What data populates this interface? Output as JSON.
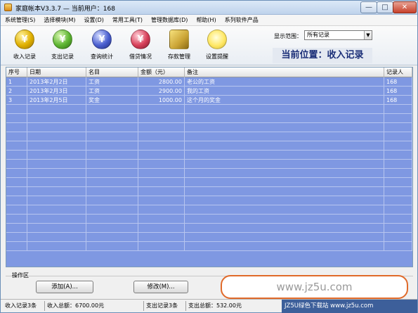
{
  "window": {
    "title": "家庭帐本V3.3.7  —  当前用户：168",
    "min_label": "—",
    "max_label": "□",
    "close_label": "✕"
  },
  "menu": [
    "系统管理(S)",
    "选择模块(M)",
    "设置(D)",
    "常用工具(T)",
    "管理数据库(D)",
    "帮助(H)",
    "系列软件产品"
  ],
  "toolbar": {
    "buttons": [
      {
        "label": "收入记录",
        "icon": "yen-gold-icon",
        "glyph": "¥",
        "color": "#e0b000"
      },
      {
        "label": "支出记录",
        "icon": "yen-green-icon",
        "glyph": "¥",
        "color": "#5db532"
      },
      {
        "label": "查询统计",
        "icon": "query-stats-icon",
        "glyph": "¥",
        "color": "#4a5fd0"
      },
      {
        "label": "借贷情况",
        "icon": "loan-icon",
        "glyph": "¥",
        "color": "#d8405a"
      },
      {
        "label": "存款管理",
        "icon": "wallet-icon",
        "glyph": "",
        "color": "#caa435"
      },
      {
        "label": "设置提醒",
        "icon": "lightbulb-icon",
        "glyph": "",
        "color": "#ffe866"
      }
    ],
    "range_label": "显示范围：",
    "range_value": "所有记录",
    "location": "当前位置：收入记录"
  },
  "table": {
    "columns": [
      "序号",
      "日期",
      "名目",
      "金额（元）",
      "备注",
      "记录人"
    ],
    "rows": [
      [
        "1",
        "2013年2月2日",
        "工资",
        "2800.00",
        "老公的工资",
        "168"
      ],
      [
        "2",
        "2013年2月3日",
        "工资",
        "2900.00",
        "我的工资",
        "168"
      ],
      [
        "3",
        "2013年2月5日",
        "奖金",
        "1000.00",
        "这个月的奖金",
        "168"
      ]
    ],
    "row_color": "#7f98e2"
  },
  "ops": {
    "label": "操作区",
    "add_button": "添加(A)...",
    "edit_button": "修改(M)..."
  },
  "watermark": "www.jz5u.com",
  "status": {
    "income_count": "收入记录3条",
    "income_total": "收入总额：6700.00元",
    "expense_count": "支出记录3条",
    "expense_total": "支出总额：532.00元",
    "site_banner": "JZ5U绿色下载站 www.jz5u.com"
  }
}
